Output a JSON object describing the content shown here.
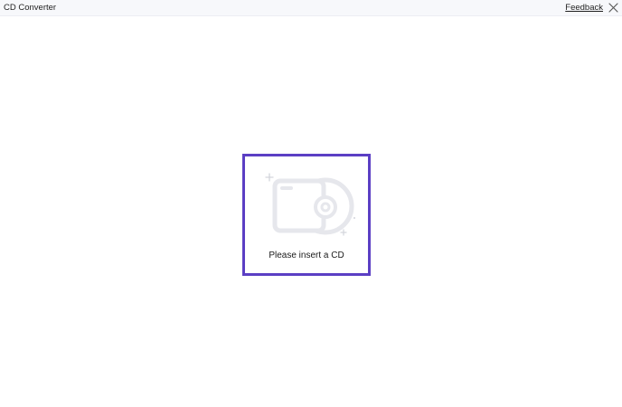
{
  "window": {
    "title": "CD Converter",
    "feedback_label": "Feedback",
    "close_icon": "close-icon"
  },
  "main": {
    "illustration_icon": "cd-drive-icon",
    "message": "Please insert a CD",
    "accent_color": "#5b3fc4"
  }
}
